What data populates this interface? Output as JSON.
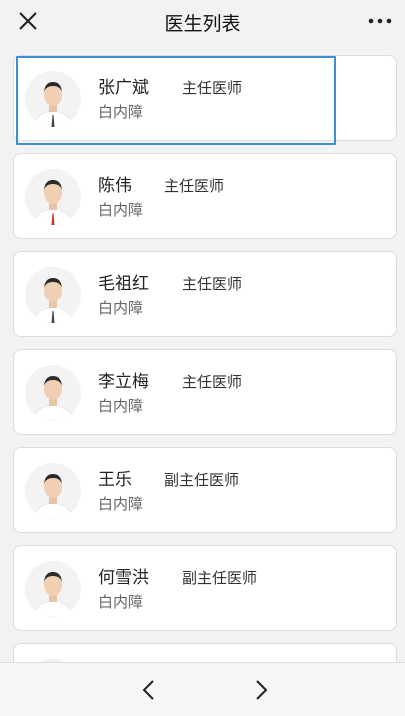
{
  "header": {
    "title": "医生列表",
    "close_icon": "close-icon",
    "more_icon": "more-icon"
  },
  "doctors": [
    {
      "name": "张广斌",
      "title": "主任医师",
      "department": "白内障",
      "shirt": "#ffffff",
      "tie": "#444444"
    },
    {
      "name": "陈伟",
      "title": "主任医师",
      "department": "白内障",
      "shirt": "#ffffff",
      "tie": "#c0392b"
    },
    {
      "name": "毛祖红",
      "title": "主任医师",
      "department": "白内障",
      "shirt": "#ffffff",
      "tie": "#444444"
    },
    {
      "name": "李立梅",
      "title": "主任医师",
      "department": "白内障",
      "shirt": "#ffffff",
      "tie": ""
    },
    {
      "name": "王乐",
      "title": "副主任医师",
      "department": "白内障",
      "shirt": "#ffffff",
      "tie": ""
    },
    {
      "name": "何雪洪",
      "title": "副主任医师",
      "department": "白内障",
      "shirt": "#ffffff",
      "tie": ""
    }
  ],
  "selected_index": 0,
  "footer": {
    "back_icon": "chevron-left-icon",
    "forward_icon": "chevron-right-icon"
  }
}
